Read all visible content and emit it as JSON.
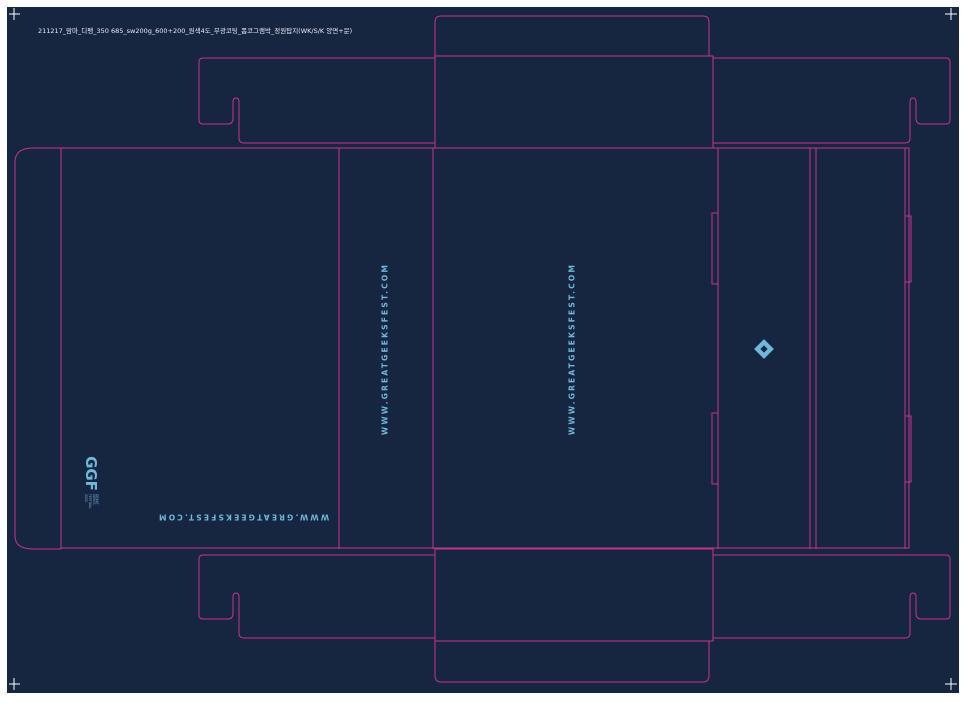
{
  "document": {
    "filename_label": "211217_맘마_디펭_350 685_sw200g_600+200_원색4도_무광코팅_폼코그램박_정원탑지(WK/S/K 양면+문)",
    "texts": {
      "url_vertical_1": "WWW.GREATGEEKSFEST.COM",
      "url_vertical_2": "WWW.GREATGEEKSFEST.COM",
      "url_upside_down": "WWW.GREATGEEKSFEST.COM",
      "logo_mark": "GGF",
      "logo_tagline": "GREAT GEEKS FESTIVAL 2021"
    },
    "icons": {
      "registration": "crosshair-registration-mark",
      "diamond": "diamond-eye-icon"
    },
    "colors": {
      "background": "#162640",
      "die_line": "#c8338c",
      "accent": "#6fb8dc",
      "page": "#ffffff"
    }
  }
}
